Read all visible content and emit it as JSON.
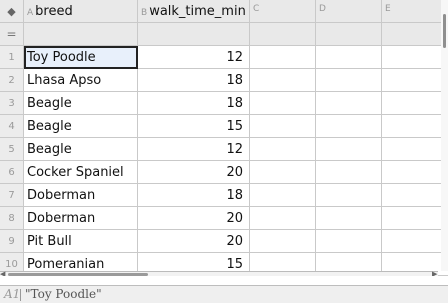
{
  "columns": [
    {
      "id": "A",
      "name": "breed"
    },
    {
      "id": "B",
      "name": "walk_time_min"
    },
    {
      "id": "C",
      "name": ""
    },
    {
      "id": "D",
      "name": ""
    },
    {
      "id": "E",
      "name": ""
    }
  ],
  "formula_row_symbol": "=",
  "rows": [
    {
      "num": "1",
      "breed": "Toy Poodle",
      "walk": "12"
    },
    {
      "num": "2",
      "breed": "Lhasa Apso",
      "walk": "18"
    },
    {
      "num": "3",
      "breed": "Beagle",
      "walk": "18"
    },
    {
      "num": "4",
      "breed": "Beagle",
      "walk": "15"
    },
    {
      "num": "5",
      "breed": "Beagle",
      "walk": "12"
    },
    {
      "num": "6",
      "breed": "Cocker Spaniel",
      "walk": "20"
    },
    {
      "num": "7",
      "breed": "Doberman",
      "walk": "18"
    },
    {
      "num": "8",
      "breed": "Doberman",
      "walk": "20"
    },
    {
      "num": "9",
      "breed": "Pit Bull",
      "walk": "20"
    },
    {
      "num": "10",
      "breed": "Pomeranian",
      "walk": "15"
    }
  ],
  "entry_line": {
    "cell_ref": "A1",
    "value": "\"Toy Poodle\""
  },
  "icons": {
    "corner": "diamond-icon",
    "formula": "equals-icon"
  }
}
